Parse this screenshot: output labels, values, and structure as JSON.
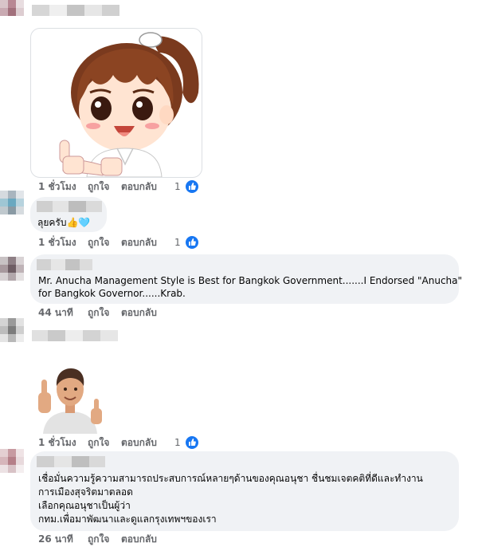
{
  "comments": [
    {
      "time": "1 ชั่วโมง",
      "like": "ถูกใจ",
      "reply": "ตอบกลับ",
      "reaction_count": "1"
    },
    {
      "text": "ลุยครับ👍🩵",
      "time": "1 ชั่วโมง",
      "like": "ถูกใจ",
      "reply": "ตอบกลับ",
      "reaction_count": "1"
    },
    {
      "text_lines": [
        "Mr. Anucha Management Style is Best for Bangkok Government.......I Endorsed \"Anucha\"",
        "for Bangkok Governor......Krab."
      ],
      "time": "44 นาที",
      "like": "ถูกใจ",
      "reply": "ตอบกลับ"
    },
    {
      "time": "1 ชั่วโมง",
      "like": "ถูกใจ",
      "reply": "ตอบกลับ",
      "reaction_count": "1"
    },
    {
      "text_lines": [
        "เชื่อมั่นความรู้ความสามารถประสบการณ์หลายๆด้านของคุณอนุชา ชื่นชมเจตคติที่ดีและทำงาน",
        "การเมืองสุจริตมาตลอด",
        "เลือกคุณอนุชาเป็นผู้ว่า",
        "กทม.เพื่อมาพัฒนาและดูแลกรุงเทพฯของเรา"
      ],
      "time": "26 นาที",
      "like": "ถูกใจ",
      "reply": "ตอบกลับ"
    }
  ],
  "colors": {
    "bubble": "#f0f2f5",
    "meta": "#65676b",
    "like_blue": "#1877f2"
  },
  "icons": {
    "reaction": "like-icon",
    "sticker_1": "cartoon-girl-thumbs-up-sticker",
    "sticker_2": "3d-man-thumbs-up-sticker"
  }
}
